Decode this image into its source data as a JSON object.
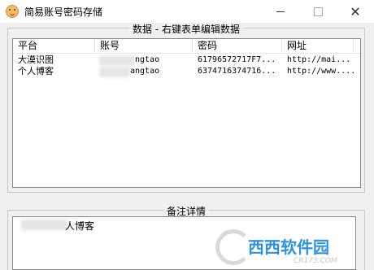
{
  "window": {
    "title": "简易账号密码存储",
    "minimize_icon": "minimize-icon",
    "maximize_icon": "maximize-icon",
    "close_glyph": "✕"
  },
  "data_group": {
    "title": "数据 - 右键表单编辑数据"
  },
  "table": {
    "columns": [
      "平台",
      "账号",
      "密码",
      "网址"
    ],
    "rows": [
      {
        "platform": "大漠识图",
        "account": "ngtao",
        "password": "6179657271​7F7...",
        "url": "http://mai..."
      },
      {
        "platform": "个人博客",
        "account": "angtao",
        "password": "63747163747​16...",
        "url": "http://www...."
      }
    ]
  },
  "notes_group": {
    "title": "备注详情",
    "text": "人博客"
  },
  "watermark": {
    "text": "西西软件园",
    "url": "CR173.COM"
  }
}
